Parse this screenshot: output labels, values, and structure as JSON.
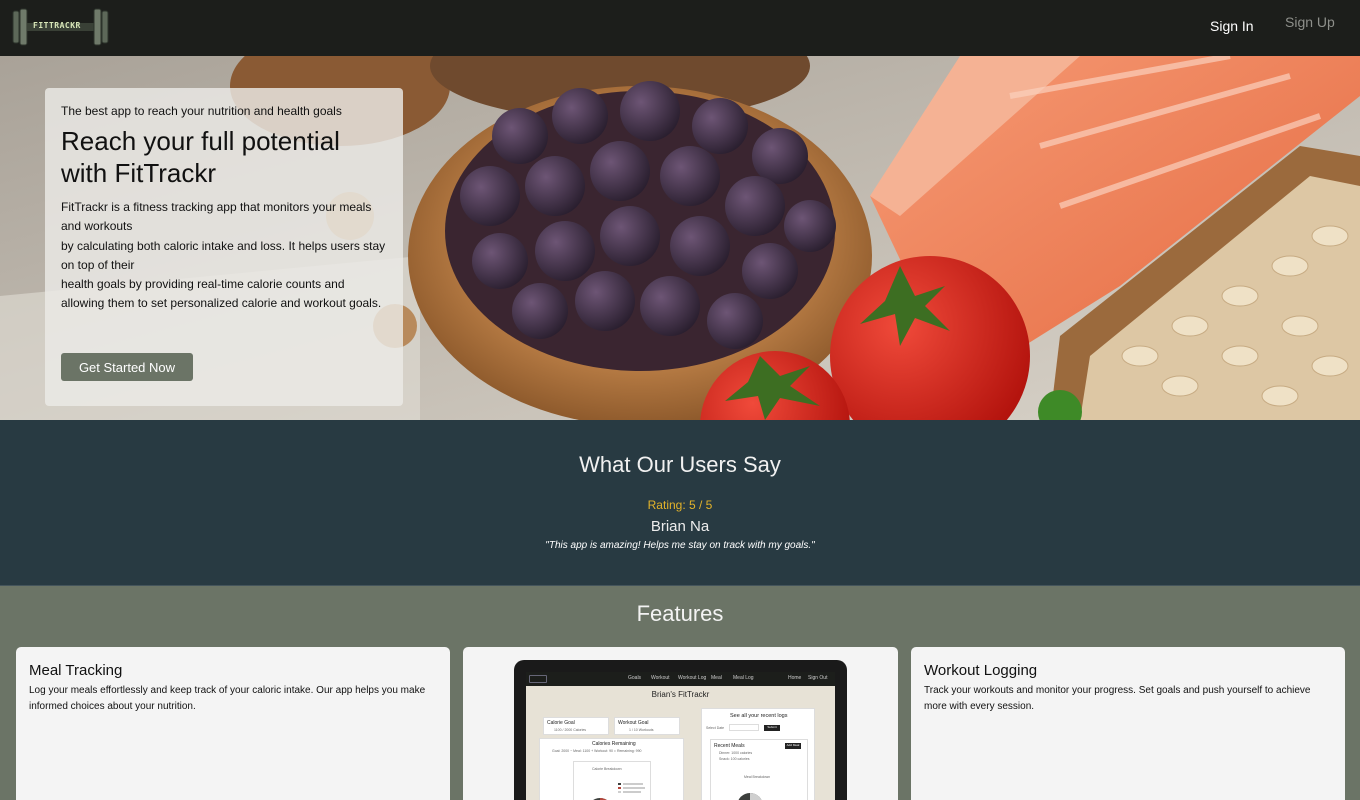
{
  "nav": {
    "logo_text": "FITTRACKR",
    "sign_in": "Sign In",
    "sign_up": "Sign Up"
  },
  "hero": {
    "eyebrow": "The best app to reach your nutrition and health goals",
    "title_line1": "Reach your full potential",
    "title_line2": "with FitTrackr",
    "desc_lines": [
      "FitTrackr is a fitness tracking app that monitors your meals and workouts",
      "by calculating both caloric intake and loss. It helps users stay on top of their",
      "health goals by providing real-time calorie counts and allowing them to set personalized calorie and workout goals."
    ],
    "cta": "Get Started Now"
  },
  "testimonials": {
    "heading": "What Our Users Say",
    "rating": "Rating: 5 / 5",
    "name": "Brian Na",
    "quote": "\"This app is amazing! Helps me stay on track with my goals.\""
  },
  "features": {
    "heading": "Features",
    "cards": [
      {
        "title": "Meal Tracking",
        "desc": "Log your meals effortlessly and keep track of your caloric intake. Our app helps you make informed choices about your nutrition."
      },
      {
        "title": "Workout Logging",
        "desc": "Track your workouts and monitor your progress. Set goals and push yourself to achieve more with every session."
      }
    ],
    "preview": {
      "nav_items": [
        "Goals",
        "Workout",
        "Workout Log",
        "Meal",
        "Meal Log",
        "Home",
        "Sign Out"
      ],
      "title": "Brian's FitTrackr",
      "calorie_goal_label": "Calorie Goal",
      "calorie_goal_value": "1100 / 2000 Calories",
      "workout_goal_label": "Workout Goal",
      "workout_goal_value": "1 / 10 Workouts",
      "remaining_label": "Calories Remaining",
      "remaining_detail": "Goal: 2000 − Meal: 1100 + Workout: 90 = Remaining: 990",
      "breakdown_label": "Calorie Breakdown",
      "recent_heading": "See all your recent logs",
      "select_label": "Select Date",
      "submit_label": "Submit",
      "recent_meals_label": "Recent Meals",
      "meals": [
        "Dinner: 1000 calories",
        "Snack: 100 calories"
      ],
      "add_meal": "Add Meal",
      "meal_breakdown": "Meal Breakdown",
      "colors": {
        "pie_dark": "#3c3f3c",
        "pie_red": "#b5453b",
        "pie_light": "#cfcfcf"
      }
    }
  },
  "colors": {
    "nav_bg": "#1c1e1b",
    "testimonial_bg": "#283a42",
    "features_bg": "#6b7466",
    "rating": "#e3b32a",
    "button": "#6b7466"
  }
}
